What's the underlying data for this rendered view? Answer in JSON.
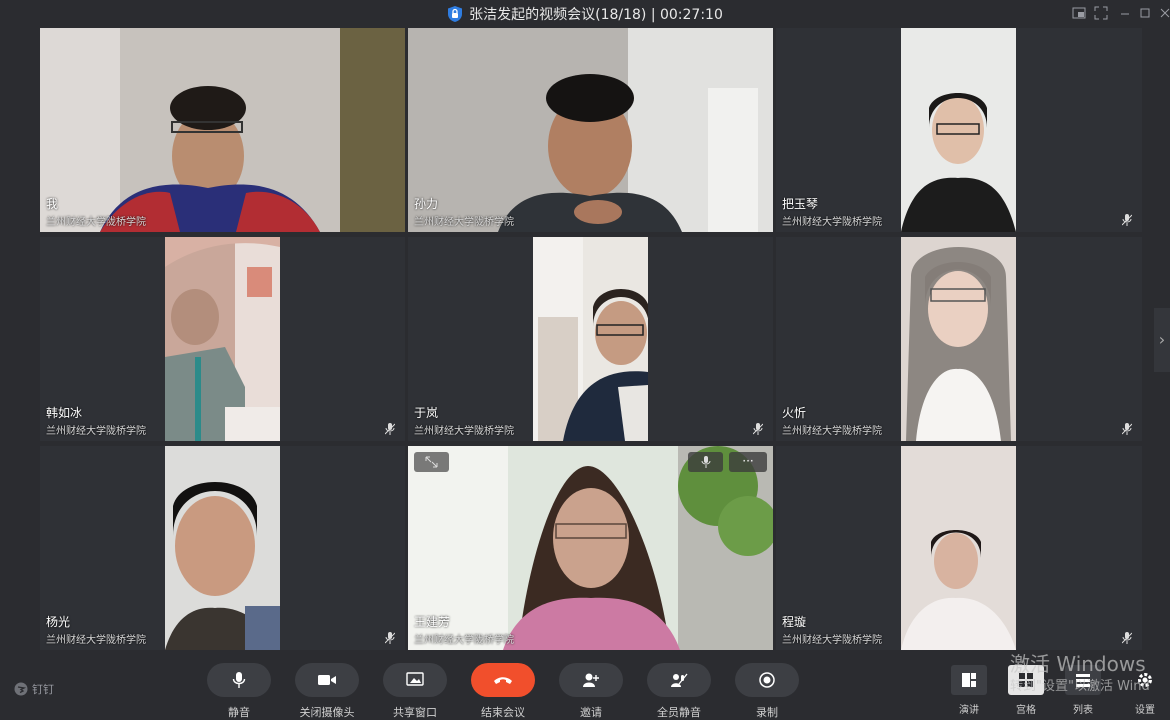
{
  "window": {
    "title": "张洁发起的视频会议(18/18) | 00:27:10"
  },
  "participants": [
    {
      "name": "我",
      "org": "兰州财经大学陇桥学院"
    },
    {
      "name": "孙力",
      "org": "兰州财经大学陇桥学院"
    },
    {
      "name": "把玉琴",
      "org": "兰州财经大学陇桥学院"
    },
    {
      "name": "韩如冰",
      "org": "兰州财经大学陇桥学院"
    },
    {
      "name": "于岚",
      "org": "兰州财经大学陇桥学院"
    },
    {
      "name": "火忻",
      "org": "兰州财经大学陇桥学院"
    },
    {
      "name": "杨光",
      "org": "兰州财经大学陇桥学院"
    },
    {
      "name": "王建芳",
      "org": "兰州财经大学陇桥学院"
    },
    {
      "name": "程璇",
      "org": "兰州财经大学陇桥学院"
    }
  ],
  "tile_controls": {
    "more_label": "···"
  },
  "controls": {
    "mute": "静音",
    "camera_off": "关闭摄像头",
    "share_window": "共享窗口",
    "end_meeting": "结束会议",
    "invite": "邀请",
    "mute_all": "全员静音",
    "record": "录制"
  },
  "right_controls": {
    "presenter": "演讲",
    "grid": "宫格",
    "list": "列表",
    "settings": "设置"
  },
  "brand": {
    "name": "钉钉"
  },
  "watermark": {
    "line1": "激活 Windows",
    "line2": "转到\"设置\"以激活 Wind"
  },
  "colors": {
    "end_button": "#f14f2c",
    "background": "#2b2c30",
    "tile": "#2f3136"
  }
}
